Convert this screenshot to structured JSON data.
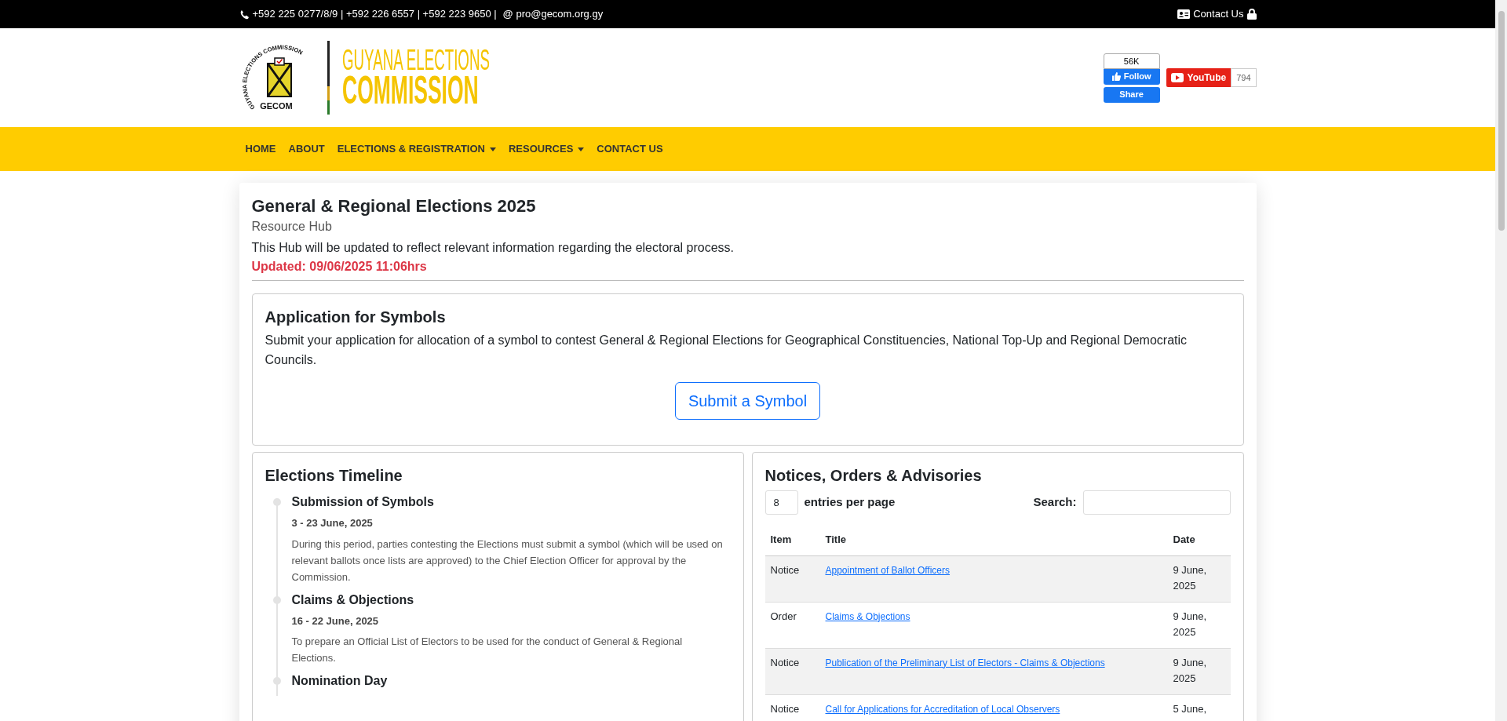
{
  "top_bar": {
    "phones": "+592 225 0277/8/9 | +592 226 6557 | +592 223 9650 |",
    "email_icon": "@",
    "email": "pro@gecom.org.gy",
    "contact": "Contact Us"
  },
  "header": {
    "logo": {
      "ring_text": "GUYANA ELECTIONS COMMISSION",
      "emblem_text": "GECOM",
      "line_1": "GUYANA ELECTIONS",
      "line_2": "COMMISSION"
    },
    "facebook": {
      "count": "56K",
      "follow": "Follow",
      "share": "Share"
    },
    "youtube": {
      "label": "YouTube",
      "count": "794"
    }
  },
  "nav": [
    {
      "label": "HOME",
      "dropdown": false
    },
    {
      "label": "ABOUT",
      "dropdown": false
    },
    {
      "label": "ELECTIONS & REGISTRATION",
      "dropdown": true
    },
    {
      "label": "RESOURCES",
      "dropdown": true
    },
    {
      "label": "CONTACT US",
      "dropdown": false
    }
  ],
  "hub": {
    "title": "General & Regional Elections 2025",
    "subtitle": "Resource Hub",
    "description": "This Hub will be updated to reflect relevant information regarding the electoral process.",
    "updated": "Updated: 09/06/2025 11:06hrs"
  },
  "application": {
    "title": "Application for Symbols",
    "text": "Submit your application for allocation of a symbol to contest General & Regional Elections for Geographical Constituencies, National Top-Up and Regional Democratic Councils.",
    "button": "Submit a Symbol"
  },
  "timeline": {
    "title": "Elections Timeline",
    "items": [
      {
        "title": "Submission of Symbols",
        "date": "3 - 23 June, 2025",
        "text": "During this period, parties contesting the Elections must submit a symbol (which will be used on relevant ballots once lists are approved) to the Chief Election Officer for approval by the Commission."
      },
      {
        "title": "Claims & Objections",
        "date": "16 - 22 June, 2025",
        "text": "To prepare an Official List of Electors to be used for the conduct of General & Regional Elections."
      },
      {
        "title": "Nomination Day"
      }
    ]
  },
  "notices": {
    "title": "Notices, Orders & Advisories",
    "entries_value": "8",
    "entries_label": "entries per page",
    "search_label": "Search:",
    "table": {
      "columns": [
        "Item",
        "Title",
        "Date"
      ],
      "rows": [
        {
          "item": "Notice",
          "title": "Appointment of Ballot Officers",
          "date": "9 June, 2025"
        },
        {
          "item": "Order",
          "title": "Claims & Objections",
          "date": "9 June, 2025"
        },
        {
          "item": "Notice",
          "title": "Publication of the Preliminary List of Electors - Claims & Objections",
          "date": "9 June, 2025"
        },
        {
          "item": "Notice",
          "title": "Call for Applications for Accreditation of Local Observers",
          "date": "5 June,"
        }
      ]
    }
  }
}
